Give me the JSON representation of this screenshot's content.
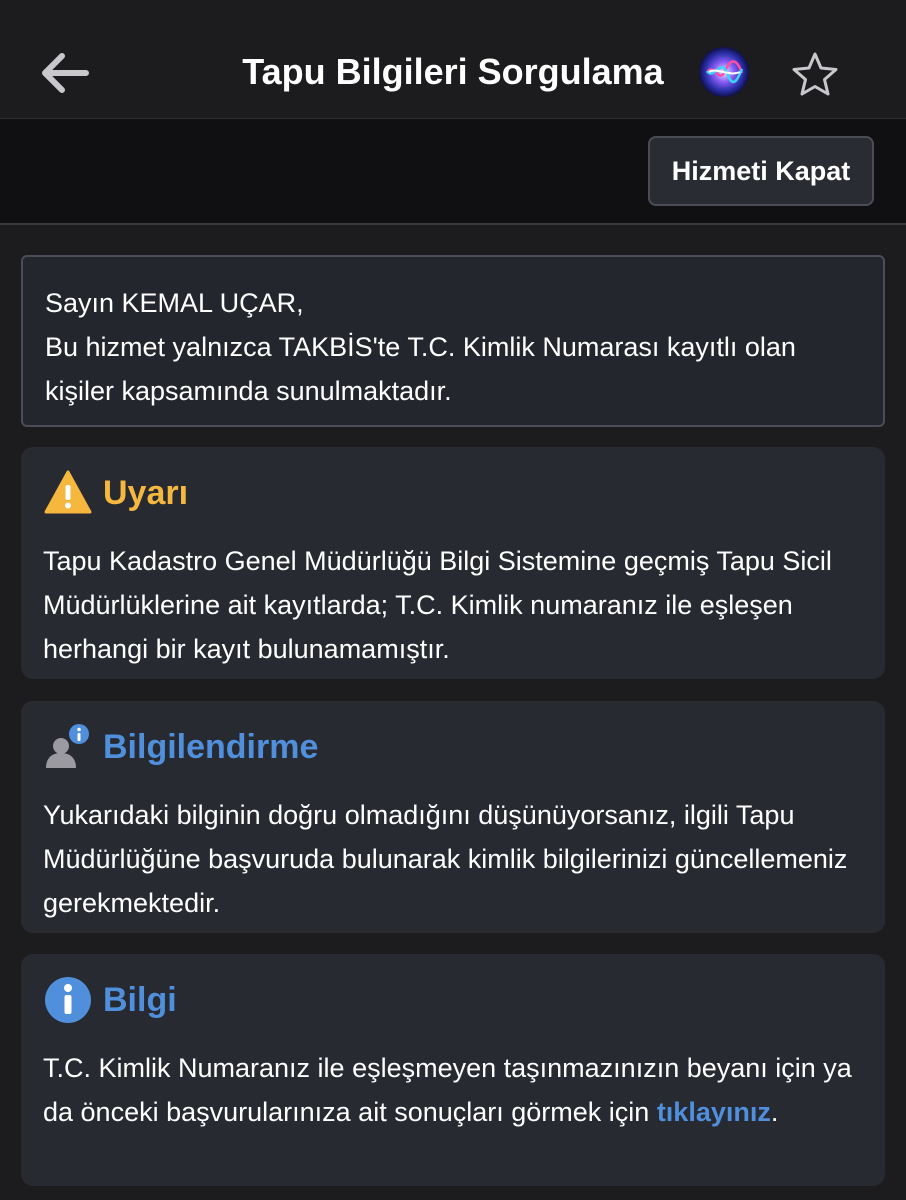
{
  "header": {
    "title": "Tapu Bilgileri Sorgulama",
    "back_icon": "back-arrow-icon",
    "assistant_icon": "siri-icon",
    "favorite_icon": "star-outline-icon"
  },
  "actions": {
    "close_service_label": "Hizmeti Kapat"
  },
  "greeting": {
    "line1": "Sayın KEMAL UÇAR,",
    "line2": "Bu hizmet yalnızca TAKBİS'te T.C. Kimlik Numarası kayıtlı olan kişiler kapsamında sunulmaktadır."
  },
  "cards": {
    "warning": {
      "icon": "warning-triangle-icon",
      "title": "Uyarı",
      "body": "Tapu Kadastro Genel Müdürlüğü Bilgi Sistemine geçmiş Tapu Sicil Müdürlüklerine ait kayıtlarda; T.C. Kimlik numaranız ile eşleşen herhangi bir kayıt bulunamamıştır."
    },
    "notice": {
      "icon": "user-info-icon",
      "title": "Bilgilendirme",
      "body": "Yukarıdaki bilginin doğru olmadığını düşünüyorsanız, ilgili Tapu Müdürlüğüne başvuruda bulunarak kimlik bilgilerinizi güncellemeniz gerekmektedir."
    },
    "info": {
      "icon": "info-circle-icon",
      "title": "Bilgi",
      "body_prefix": "T.C. Kimlik Numaranız ile eşleşmeyen taşınmazınızın beyanı için ya da önceki başvurularınıza ait sonuçları görmek için ",
      "link_text": "tıklayınız",
      "body_suffix": "."
    }
  },
  "colors": {
    "background": "#1c1c1e",
    "card": "#272a31",
    "warning_accent": "#f5b73e",
    "info_accent": "#4f8fdb"
  }
}
